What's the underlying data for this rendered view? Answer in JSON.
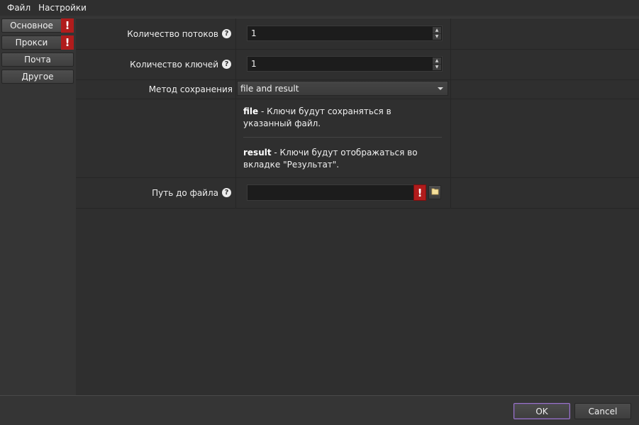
{
  "menu": {
    "file": "Файл",
    "settings": "Настройки"
  },
  "nav": {
    "items": [
      {
        "label": "Основное",
        "warning": true
      },
      {
        "label": "Прокси",
        "warning": true
      },
      {
        "label": "Почта",
        "warning": false
      },
      {
        "label": "Другое",
        "warning": false
      }
    ],
    "warning_glyph": "!"
  },
  "form": {
    "threads": {
      "label": "Количество потоков",
      "value": "1"
    },
    "keys": {
      "label": "Количество ключей",
      "value": "1"
    },
    "save_method": {
      "label": "Метод сохранения",
      "value": "file and result"
    },
    "descriptions": {
      "file_keyword": "file",
      "file_text": " - Ключи будут сохраняться в указанный файл.",
      "result_keyword": "result",
      "result_text": " - Ключи будут отображаться во вкладке \"Результат\"."
    },
    "file_path": {
      "label": "Путь до файла",
      "value": "",
      "warning_glyph": "!"
    },
    "help_glyph": "?"
  },
  "buttons": {
    "ok": "OK",
    "cancel": "Cancel"
  },
  "colors": {
    "warning": "#b01c1c",
    "ok_border": "#9a76c8",
    "background": "#353535"
  },
  "icons": {
    "help": "help-icon",
    "warning": "warning-icon",
    "folder": "folder-icon",
    "spin_up": "spin-up-icon",
    "spin_down": "spin-down-icon",
    "dropdown": "chevron-down-icon"
  }
}
